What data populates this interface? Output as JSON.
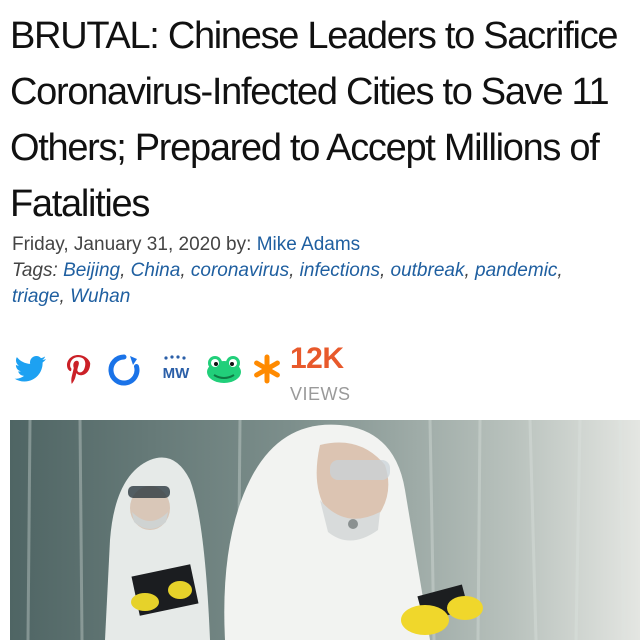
{
  "article": {
    "title": "BRUTAL: Chinese Leaders to Sacrifice Coronavirus-Infected Cities to Save 11 Others; Prepared to Accept Millions of Fatalities",
    "date": "Friday, January 31, 2020",
    "by_label": " by: ",
    "author": "Mike Adams",
    "tags_label": "Tags: ",
    "tags": [
      "Beijing",
      "China",
      "coronavirus",
      "infections",
      "outbreak",
      "pandemic",
      "triage",
      "Wuhan"
    ]
  },
  "share_bar": {
    "icons": [
      "twitter-icon",
      "pinterest-icon",
      "social-ring-icon",
      "mewe-icon",
      "gab-icon",
      "star-icon"
    ],
    "mewe_text": "MW",
    "views_count": "12K",
    "views_label": "VIEWS",
    "colors": {
      "twitter": "#1da1f2",
      "pinterest": "#cb2027",
      "ring": "#1a73e8",
      "mewe": "#2b5fa8",
      "gab": "#21cf7a",
      "star": "#ff8a00",
      "views": "#e8592b"
    }
  },
  "hero_image": {
    "alt_subject": "two people in white protective suits and masks with yellow gloves"
  }
}
